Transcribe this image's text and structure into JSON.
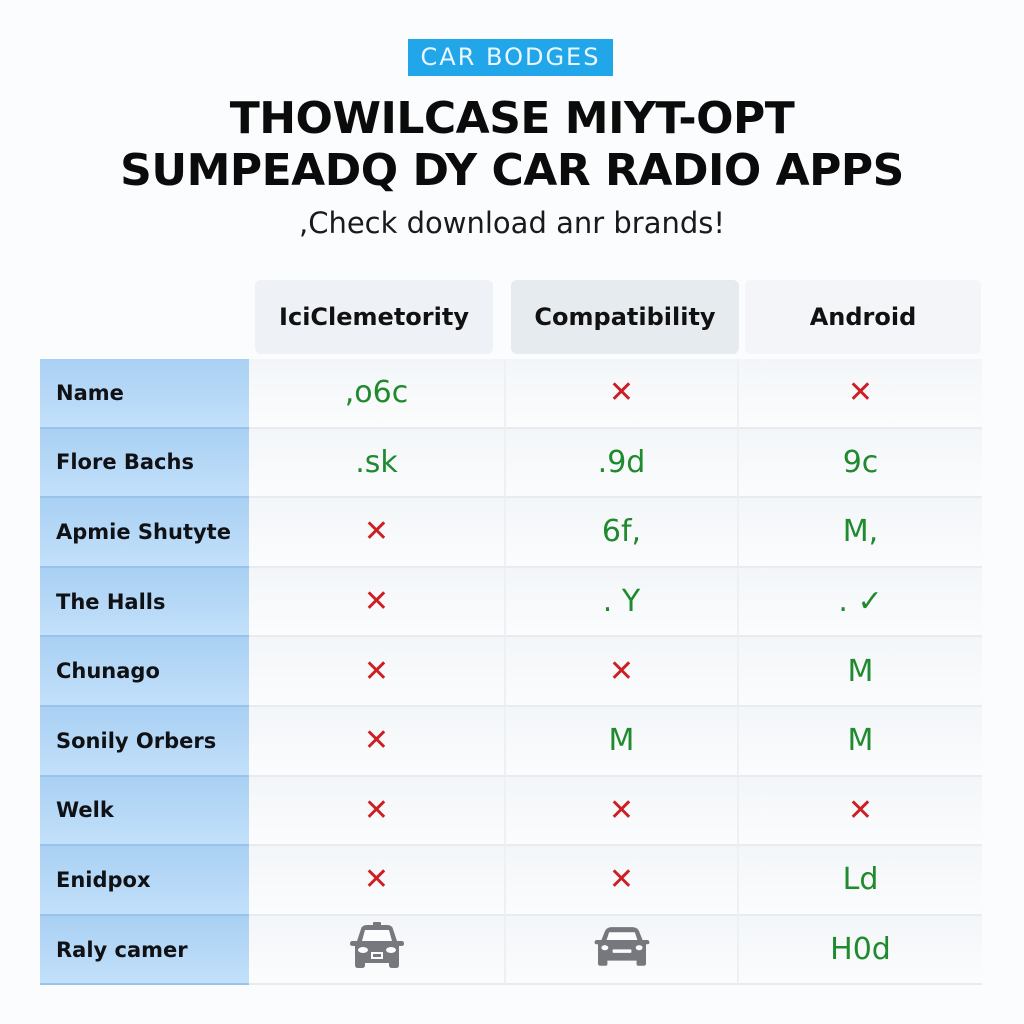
{
  "header": {
    "badge": "CAR BODGES",
    "title_line1": "THOWILCASE MIYT-OPT",
    "title_line2": "SUMPEADQ DY CAR RADIO APPS",
    "subtitle": ",Check download anr brands!"
  },
  "colors": {
    "badge": "#22a6ea",
    "positive": "#1f8a2e",
    "negative": "#cc1f24",
    "name_column": "#b3d7f6",
    "icon_gray": "#77787d"
  },
  "table": {
    "columns": [
      "IciClemetority",
      "Compatibility",
      "Android"
    ],
    "rows": [
      {
        "name": "Name",
        "cells": [
          {
            "type": "text",
            "value": ",o6c"
          },
          {
            "type": "cross",
            "value": "✕"
          },
          {
            "type": "cross",
            "value": "✕"
          }
        ]
      },
      {
        "name": "Flore Bachs",
        "cells": [
          {
            "type": "text",
            "value": ".sk"
          },
          {
            "type": "text",
            "value": ".9d"
          },
          {
            "type": "text",
            "value": "9c"
          }
        ]
      },
      {
        "name": "Apmie Shutyte",
        "cells": [
          {
            "type": "cross",
            "value": "✕"
          },
          {
            "type": "text",
            "value": "6f,"
          },
          {
            "type": "text",
            "value": "M,"
          }
        ]
      },
      {
        "name": "The Halls",
        "cells": [
          {
            "type": "cross",
            "value": "✕"
          },
          {
            "type": "text",
            "value": ". Y"
          },
          {
            "type": "text",
            "value": ". ✓"
          }
        ]
      },
      {
        "name": "Chunago",
        "cells": [
          {
            "type": "cross",
            "value": "✕"
          },
          {
            "type": "cross",
            "value": "✕"
          },
          {
            "type": "text",
            "value": "M"
          }
        ]
      },
      {
        "name": "Sonily Orbers",
        "cells": [
          {
            "type": "cross",
            "value": "✕"
          },
          {
            "type": "text",
            "value": "M"
          },
          {
            "type": "text",
            "value": "M"
          }
        ]
      },
      {
        "name": "Welk",
        "cells": [
          {
            "type": "cross",
            "value": "✕"
          },
          {
            "type": "cross",
            "value": "✕"
          },
          {
            "type": "cross",
            "value": "✕"
          }
        ]
      },
      {
        "name": "Enidpox",
        "cells": [
          {
            "type": "cross",
            "value": "✕"
          },
          {
            "type": "cross",
            "value": "✕"
          },
          {
            "type": "text",
            "value": "Ld"
          }
        ]
      },
      {
        "name": "Raly camer",
        "cells": [
          {
            "type": "icon",
            "value": "taxi-icon"
          },
          {
            "type": "icon",
            "value": "car-icon"
          },
          {
            "type": "text",
            "value": "H0d"
          }
        ]
      }
    ]
  }
}
